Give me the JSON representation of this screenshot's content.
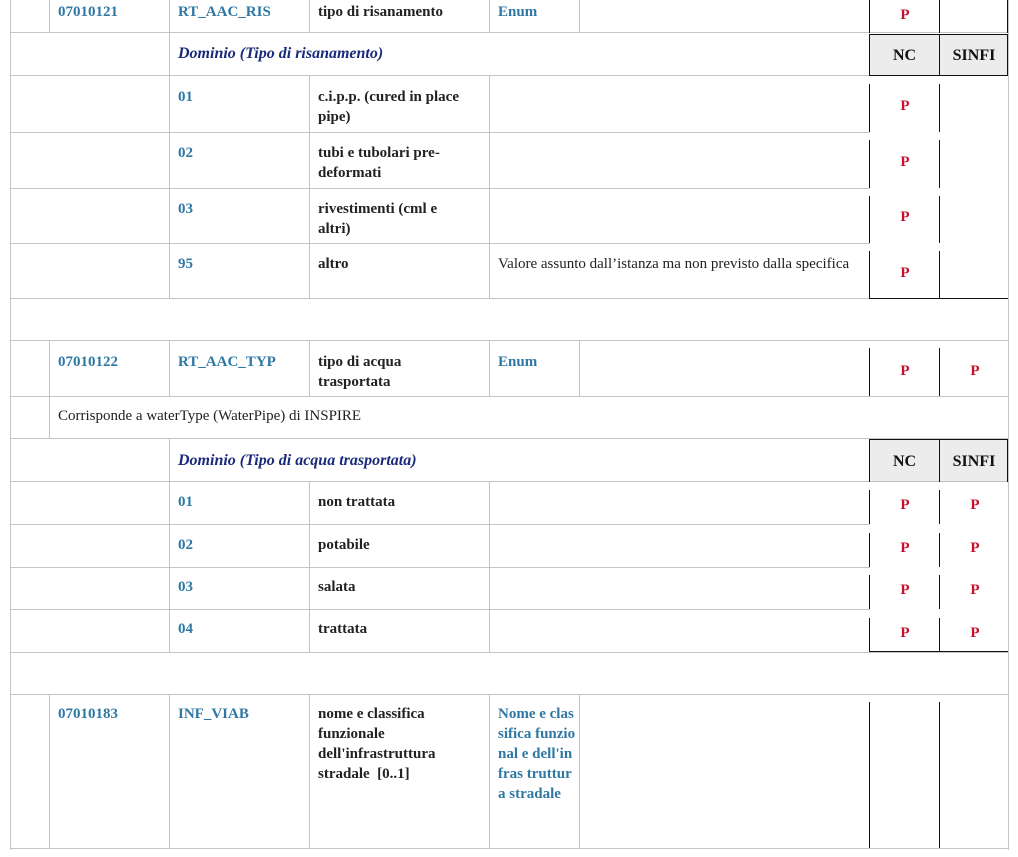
{
  "block_ris": {
    "attr": {
      "code": "07010121",
      "name": "RT_AAC_RIS",
      "desc": "tipo di risanamento",
      "type": "Enum",
      "nc": "P",
      "sinfi": ""
    },
    "domain_title": "Dominio (Tipo di risanamento)",
    "col_nc": "NC",
    "col_sinfi": "SINFI",
    "values": [
      {
        "code": "01",
        "label": "c.i.p.p. (cured in place pipe)",
        "note": "",
        "nc": "P",
        "sinfi": ""
      },
      {
        "code": "02",
        "label": "tubi e tubolari pre-deformati",
        "note": "",
        "nc": "P",
        "sinfi": ""
      },
      {
        "code": "03",
        "label": "rivestimenti (cml e altri)",
        "note": "",
        "nc": "P",
        "sinfi": ""
      },
      {
        "code": "95",
        "label": "altro",
        "note": "Valore assunto dall’istanza ma non previsto dalla specifica",
        "nc": "P",
        "sinfi": ""
      }
    ]
  },
  "block_typ": {
    "attr": {
      "code": "07010122",
      "name": "RT_AAC_TYP",
      "desc": "tipo di acqua trasportata",
      "type": "Enum",
      "nc": "P",
      "sinfi": "P"
    },
    "note": "Corrisponde a waterType (WaterPipe) di INSPIRE",
    "domain_title": "Dominio (Tipo di acqua trasportata)",
    "col_nc": "NC",
    "col_sinfi": "SINFI",
    "values": [
      {
        "code": "01",
        "label": "non trattata",
        "nc": "P",
        "sinfi": "P"
      },
      {
        "code": "02",
        "label": "potabile",
        "nc": "P",
        "sinfi": "P"
      },
      {
        "code": "03",
        "label": "salata",
        "nc": "P",
        "sinfi": "P"
      },
      {
        "code": "04",
        "label": "trattata",
        "nc": "P",
        "sinfi": "P"
      }
    ]
  },
  "block_viab": {
    "attr": {
      "code": "07010183",
      "name": "INF_VIAB",
      "desc": "nome e classifica funzionale dell'infrastruttura stradale  [0..1]",
      "type": "Nome e classifica funzional e dell'infras truttura stradale",
      "nc": "",
      "sinfi": ""
    }
  }
}
